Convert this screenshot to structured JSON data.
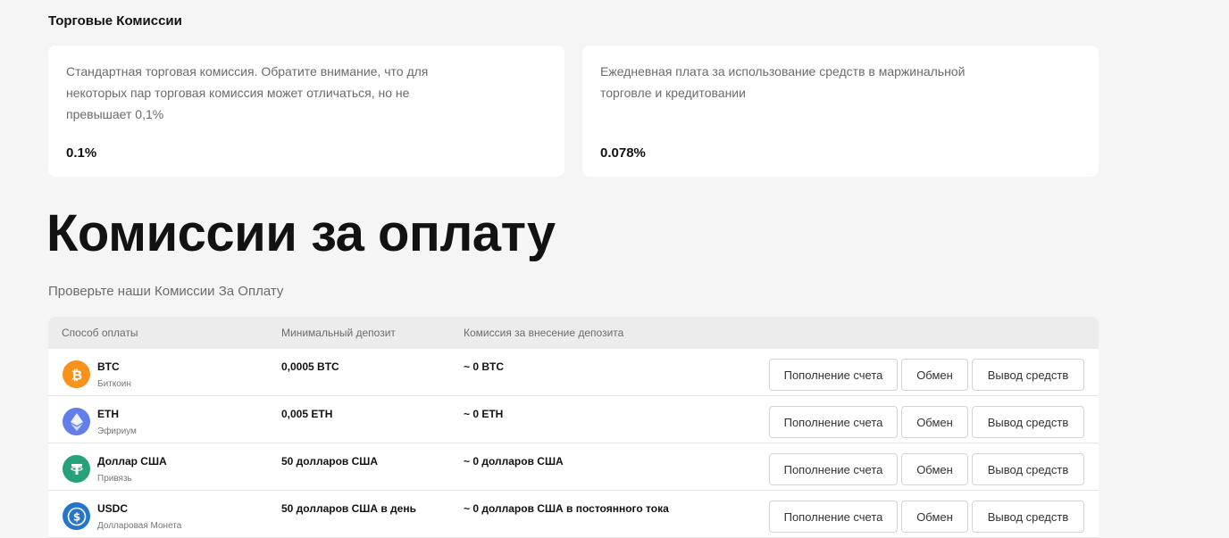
{
  "trading": {
    "title": "Торговые Комиссии",
    "cards": [
      {
        "desc": "Стандартная торговая комиссия. Обратите внимание, что для некоторых пар торговая комиссия может отличаться, но не превышает 0,1%",
        "value": "0.1%"
      },
      {
        "desc": "Ежедневная плата за использование средств в маржинальной торговле и кредитовании",
        "value": "0.078%"
      }
    ]
  },
  "payment": {
    "title": "Комиссии за оплату",
    "subtitle": "Проверьте наши Комиссии За Оплату",
    "columns": [
      "Способ оплаты",
      "Минимальный депозит",
      "Комиссия за внесение депозита"
    ],
    "buttons": {
      "deposit": "Пополнение счета",
      "exchange": "Обмен",
      "withdraw": "Вывод средств"
    },
    "rows": [
      {
        "name": "BTC",
        "sub": "Биткоин",
        "min": "0,0005 BTC",
        "fee": "~ 0 BTC",
        "icon": "bitcoin-icon",
        "color": "#f7931a"
      },
      {
        "name": "ETH",
        "sub": "Эфириум",
        "min": "0,005 ETH",
        "fee": "~ 0 ETH",
        "icon": "ethereum-icon",
        "color": "#627eea"
      },
      {
        "name": "Доллар США",
        "sub": "Привязь",
        "min": "50 долларов США",
        "fee": "~ 0 долларов США",
        "icon": "tether-icon",
        "color": "#26a17b"
      },
      {
        "name": "USDC",
        "sub": "Долларовая Монета",
        "min": "50 долларов США в день",
        "fee": "~ 0 долларов США в постоянного тока",
        "icon": "usdc-icon",
        "color": "#2775ca"
      }
    ]
  }
}
